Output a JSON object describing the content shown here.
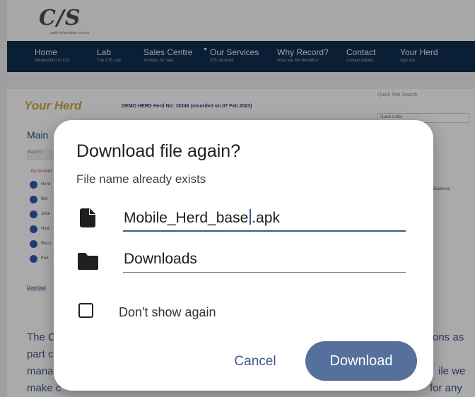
{
  "site": {
    "logo_text": "C/S",
    "logo_tagline": "cattle information service",
    "nav": [
      {
        "label": "Home",
        "sub": "Introduction to CIS"
      },
      {
        "label": "Lab",
        "sub": "The CIS Lab"
      },
      {
        "label": "Sales Centre",
        "sub": "Animals for sale"
      },
      {
        "label": "Our Services",
        "sub": "CIS services"
      },
      {
        "label": "Why Record?",
        "sub": "what are the benefits?"
      },
      {
        "label": "Contact",
        "sub": "contact details"
      },
      {
        "label": "Your Herd",
        "sub": "sign out"
      }
    ],
    "your_herd_title": "Your Herd",
    "demo_line": "DEMO HERD Herd No: 10346 (recorded on 07 Feb 2023)",
    "quick_search_label": "Quick Text Search",
    "quick_links": "Quick Links",
    "main_heading": "Main",
    "search_placeholder": "Search",
    "goto_label": "- Go to Herd",
    "side_items": [
      "Herd",
      "Brd",
      "John",
      "Heal",
      "Reco",
      "Fert"
    ],
    "download_link": "Download",
    "solutions_text": "Solutions",
    "body_lines": [
      {
        "left": "The C",
        "right": "ons as"
      },
      {
        "left": "part c",
        "right": ""
      },
      {
        "left": "mana",
        "right": "ile we"
      },
      {
        "left": "make c",
        "right": "for any"
      }
    ]
  },
  "dialog": {
    "title": "Download file again?",
    "subtitle": "File name already exists",
    "file_name_before_caret": "Mobile_Herd_base",
    "file_name_after_caret": ".apk",
    "folder": "Downloads",
    "checkbox_label": "Don't show again",
    "checkbox_checked": false,
    "cancel_label": "Cancel",
    "download_label": "Download",
    "accent_color": "#3e5a8a",
    "button_color": "#56709e"
  }
}
